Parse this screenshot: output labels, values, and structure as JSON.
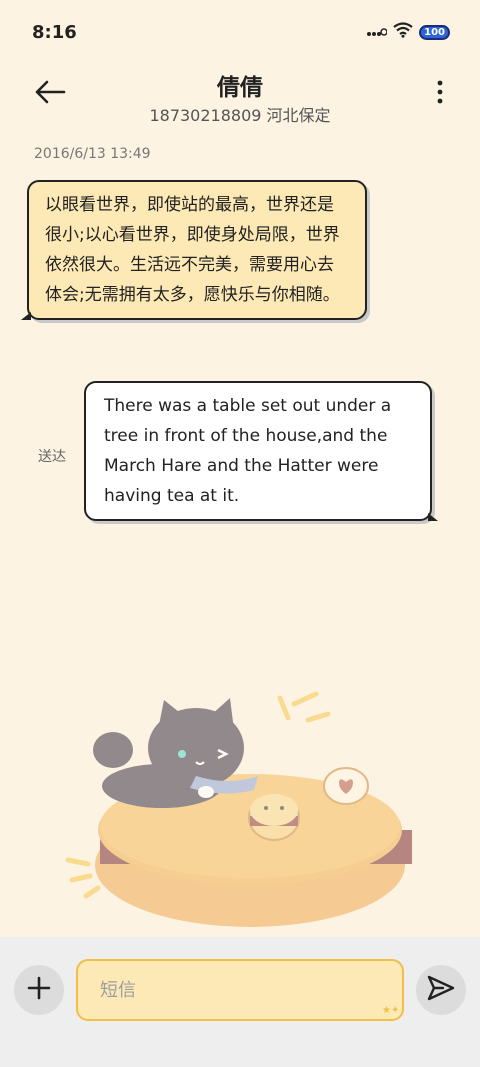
{
  "status_bar": {
    "time": "8:16",
    "battery": "100"
  },
  "header": {
    "title": "倩倩",
    "subtitle": "18730218809 河北保定"
  },
  "conversation": {
    "timestamp": "2016/6/13 13:49",
    "incoming": "以眼看世界，即使站的最高，世界还是很小;以心看世界，即使身处局限，世界依然很大。生活远不完美，需要用心去体会;无需拥有太多，愿快乐与你相随。",
    "outgoing": "There was a table set out under a tree in front of the house,and the March Hare and the Hatter were having tea at it.",
    "sent_status": "送达"
  },
  "composer": {
    "placeholder": "短信"
  },
  "colors": {
    "background": "#fdf3e3",
    "incoming_bubble": "#fde9b6",
    "outgoing_bubble": "#ffffff",
    "accent": "#f0bf45"
  },
  "icons": [
    "back-arrow-icon",
    "more-vertical-icon",
    "plus-icon",
    "send-icon",
    "wifi-icon",
    "signal-icon",
    "battery-icon"
  ]
}
